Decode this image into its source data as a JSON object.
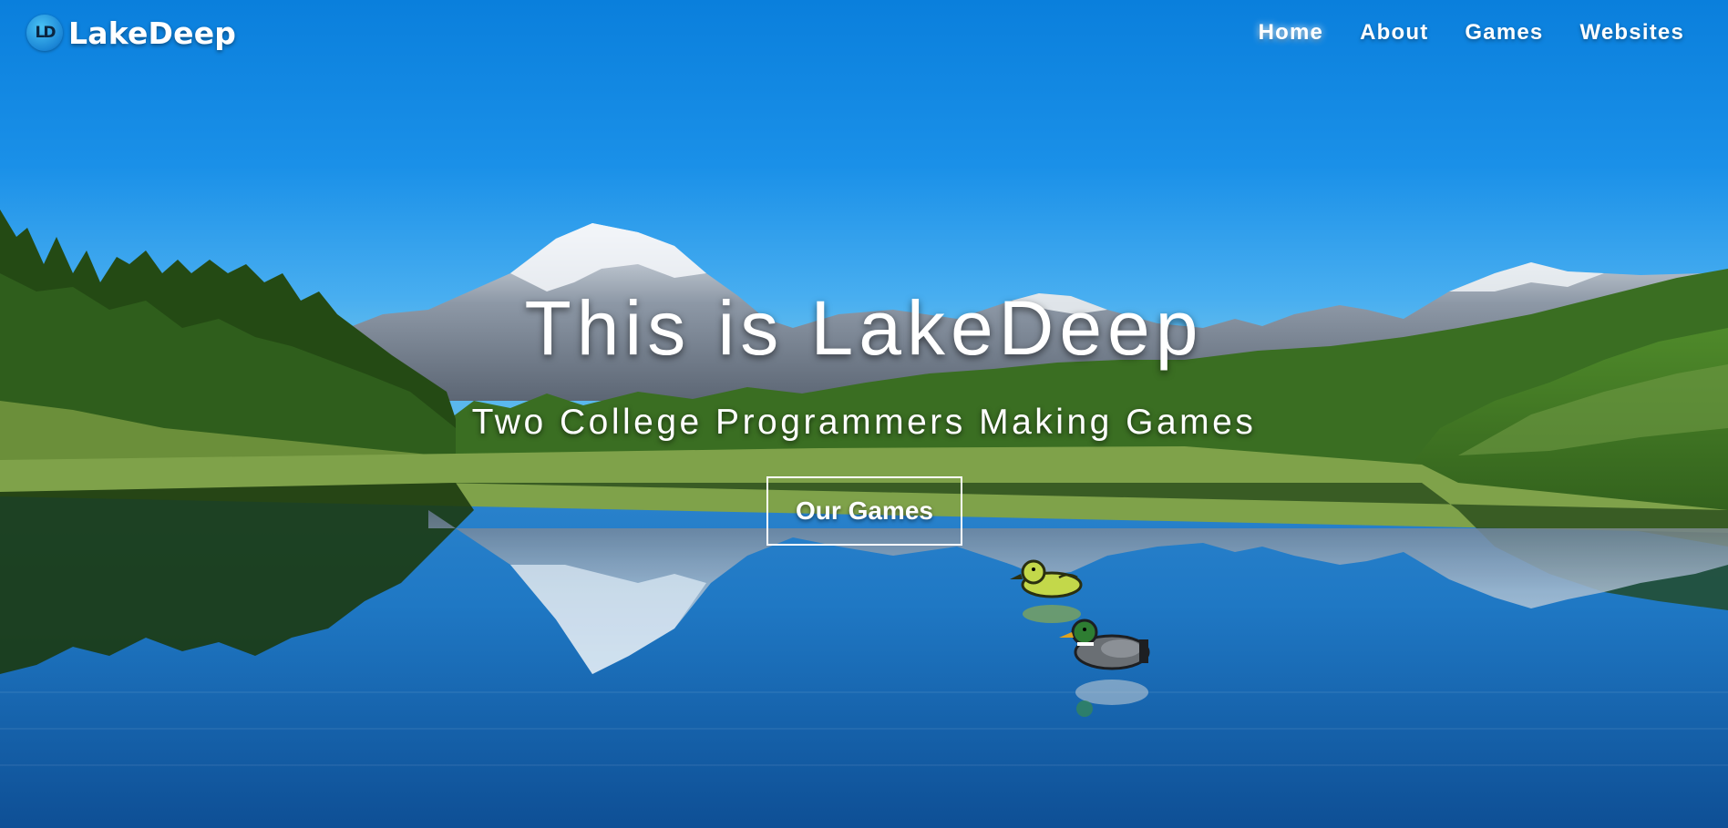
{
  "brand": {
    "name": "LakeDeep",
    "logo_mark": "LD",
    "accent": "#1b86d6"
  },
  "nav": {
    "items": [
      {
        "label": "Home",
        "active": true
      },
      {
        "label": "About",
        "active": false
      },
      {
        "label": "Games",
        "active": false
      },
      {
        "label": "Websites",
        "active": false
      }
    ]
  },
  "hero": {
    "title": "This is LakeDeep",
    "subtitle": "Two College Programmers Making Games",
    "cta_label": "Our Games",
    "background": "mountain-lake-photo",
    "sprites": [
      "yellow-duck-sprite",
      "mallard-duck-sprite"
    ]
  },
  "colors": {
    "sky_top": "#0a7fdc",
    "water": "#1e7ec6",
    "forest": "#2f5d1f",
    "text": "#ffffff"
  }
}
